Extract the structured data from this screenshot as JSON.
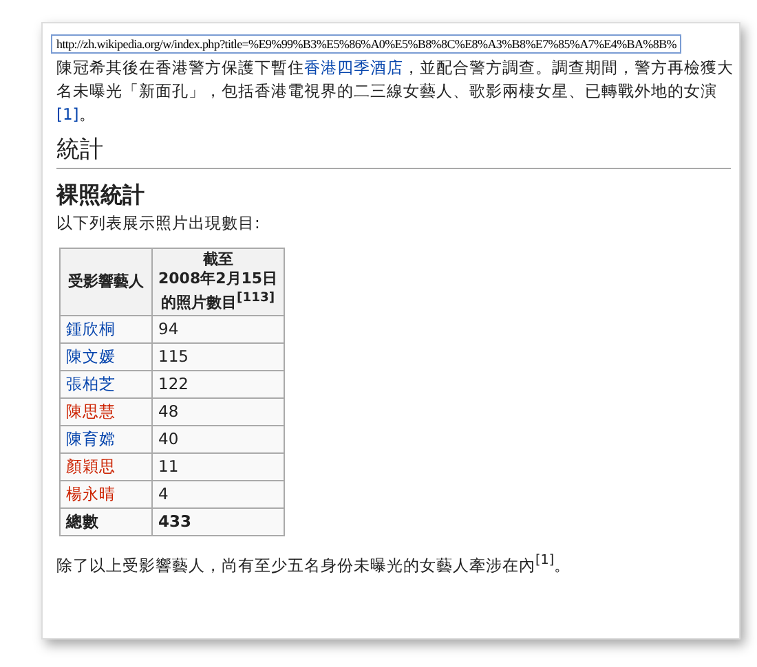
{
  "address_bar": {
    "url": "http://zh.wikipedia.org/w/index.php?title=%E9%99%B3%E5%86%A0%E5%B8%8C%E8%A3%B8%E7%85%A7%E4%BA%8B%"
  },
  "intro": {
    "lines": [
      [
        {
          "text": "陳冠希其後在香港警方保護下暫住",
          "link": false
        },
        {
          "text": "香港四季酒店",
          "link": true
        },
        {
          "text": "，並配合警方調查。調查期間，警方再檢獲大",
          "link": false
        }
      ],
      [
        {
          "text": "名未曝光「新面孔」，包括香港電視界的二三線女藝人、歌影兩棲女星、已轉戰外地的女演",
          "link": false
        }
      ],
      [
        {
          "text": "[1]",
          "link": true
        },
        {
          "text": "。",
          "link": false
        }
      ]
    ]
  },
  "section_heading": "統計",
  "subsection_heading": "裸照統計",
  "table_caption": "以下列表展示照片出現數目:",
  "table": {
    "columns": [
      {
        "lines": [
          "受影響藝人"
        ]
      },
      {
        "lines": [
          "截至",
          "2008年2月15日",
          "的照片數目$^{[113]}$"
        ]
      }
    ],
    "rows": [
      {
        "name": "鍾欣桐",
        "count": "94",
        "color": "#0645ad"
      },
      {
        "name": "陳文媛",
        "count": "115",
        "color": "#0645ad"
      },
      {
        "name": "張柏芝",
        "count": "122",
        "color": "#0645ad"
      },
      {
        "name": "陳思慧",
        "count": "48",
        "color": "#cc2200"
      },
      {
        "name": "陳育嫦",
        "count": "40",
        "color": "#0645ad"
      },
      {
        "name": "顏穎思",
        "count": "11",
        "color": "#cc2200"
      },
      {
        "name": "楊永晴",
        "count": "4",
        "color": "#cc2200"
      }
    ],
    "total": {
      "label": "總數",
      "count": "433"
    }
  },
  "closing": "除了以上受影響藝人，尚有至少五名身份未曝光的女藝人牽涉在內$^{[1]}$。"
}
